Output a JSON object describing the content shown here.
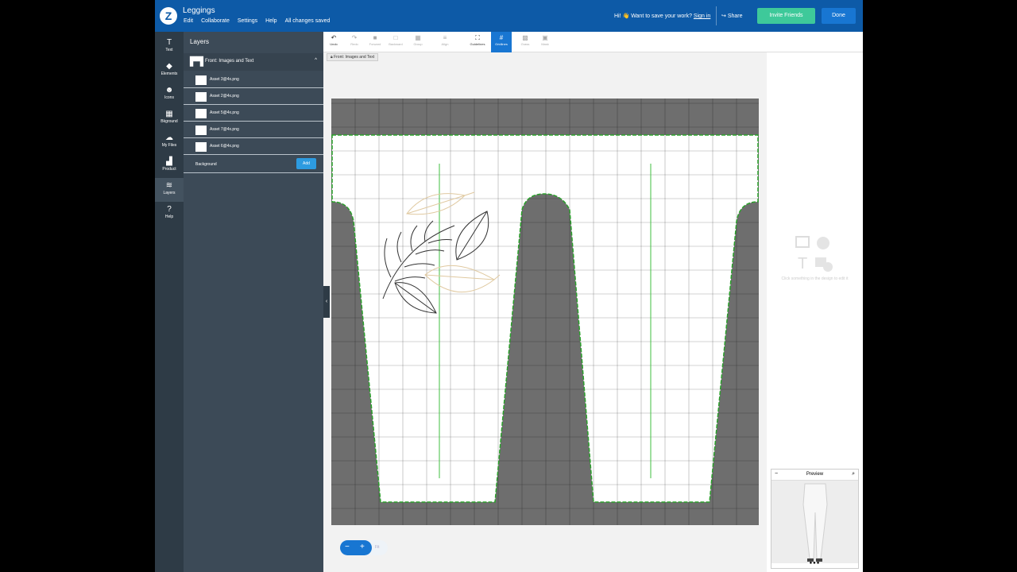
{
  "header": {
    "logo": "Z",
    "title": "Leggings",
    "menu": [
      "Edit",
      "Collaborate",
      "Settings",
      "Help",
      "All changes saved"
    ],
    "hi": "Hi!",
    "wave": "👋",
    "prompt": "Want to save your work?",
    "sign_in": "Sign in",
    "share": "Share",
    "invite": "Invite Friends",
    "done": "Done"
  },
  "rail": [
    {
      "label": "Text",
      "icon": "T",
      "icon_name": "text-icon"
    },
    {
      "label": "Elements",
      "icon": "◆",
      "icon_name": "elements-icon"
    },
    {
      "label": "Icons",
      "icon": "☻",
      "icon_name": "icons-icon"
    },
    {
      "label": "Bkground",
      "icon": "▦",
      "icon_name": "background-icon"
    },
    {
      "label": "My Files",
      "icon": "☁",
      "icon_name": "cloud-upload-icon"
    },
    {
      "label": "Product",
      "icon": "▟",
      "icon_name": "product-icon"
    },
    {
      "label": "Layers",
      "icon": "≋",
      "icon_name": "layers-icon"
    },
    {
      "label": "Help",
      "icon": "?",
      "icon_name": "help-icon"
    }
  ],
  "layers_panel": {
    "title": "Layers",
    "group": "Front: Images and Text",
    "group_chevron": "^",
    "layers": [
      "Asset 3@4x.png",
      "Asset 2@4x.png",
      "Asset 5@4x.png",
      "Asset 7@4x.png",
      "Asset 6@4x.png"
    ],
    "background_label": "Background",
    "add_label": "Add"
  },
  "toolbar": [
    {
      "label": "Undo",
      "icon": "↶",
      "enabled": true
    },
    {
      "label": "Redo",
      "icon": "↷",
      "enabled": false
    },
    {
      "label": "Forward",
      "icon": "■",
      "enabled": false
    },
    {
      "label": "Backward",
      "icon": "□",
      "enabled": false
    },
    {
      "label": "Group",
      "icon": "▦",
      "enabled": false
    },
    {
      "label": "Align",
      "icon": "≡",
      "enabled": false
    },
    {
      "label": "Guidelines",
      "icon": "⛶",
      "enabled": true
    },
    {
      "label": "Gridlines",
      "icon": "#",
      "enabled": true,
      "active": true
    },
    {
      "label": "Grass",
      "icon": "▩",
      "enabled": false
    },
    {
      "label": "Mask",
      "icon": "▣",
      "enabled": false
    }
  ],
  "breadcrumb": "Front: Images and Text",
  "right_panel": {
    "hint": "Click something in the design to edit it"
  },
  "zoom": {
    "minus": "−",
    "plus": "+",
    "fit": "Fit"
  },
  "preview": {
    "minimize": "−",
    "title": "Preview",
    "zoom_icon": "⌕",
    "dots": "●●●"
  },
  "colors": {
    "header_bg": "#0d5aa7",
    "accent_green": "#3ec99a",
    "accent_blue": "#1876d2",
    "panel_bg": "#3c4a57",
    "rail_bg": "#2e3b46",
    "canvas_outside": "#6e6e6e",
    "cut_line": "#2aa02a"
  }
}
